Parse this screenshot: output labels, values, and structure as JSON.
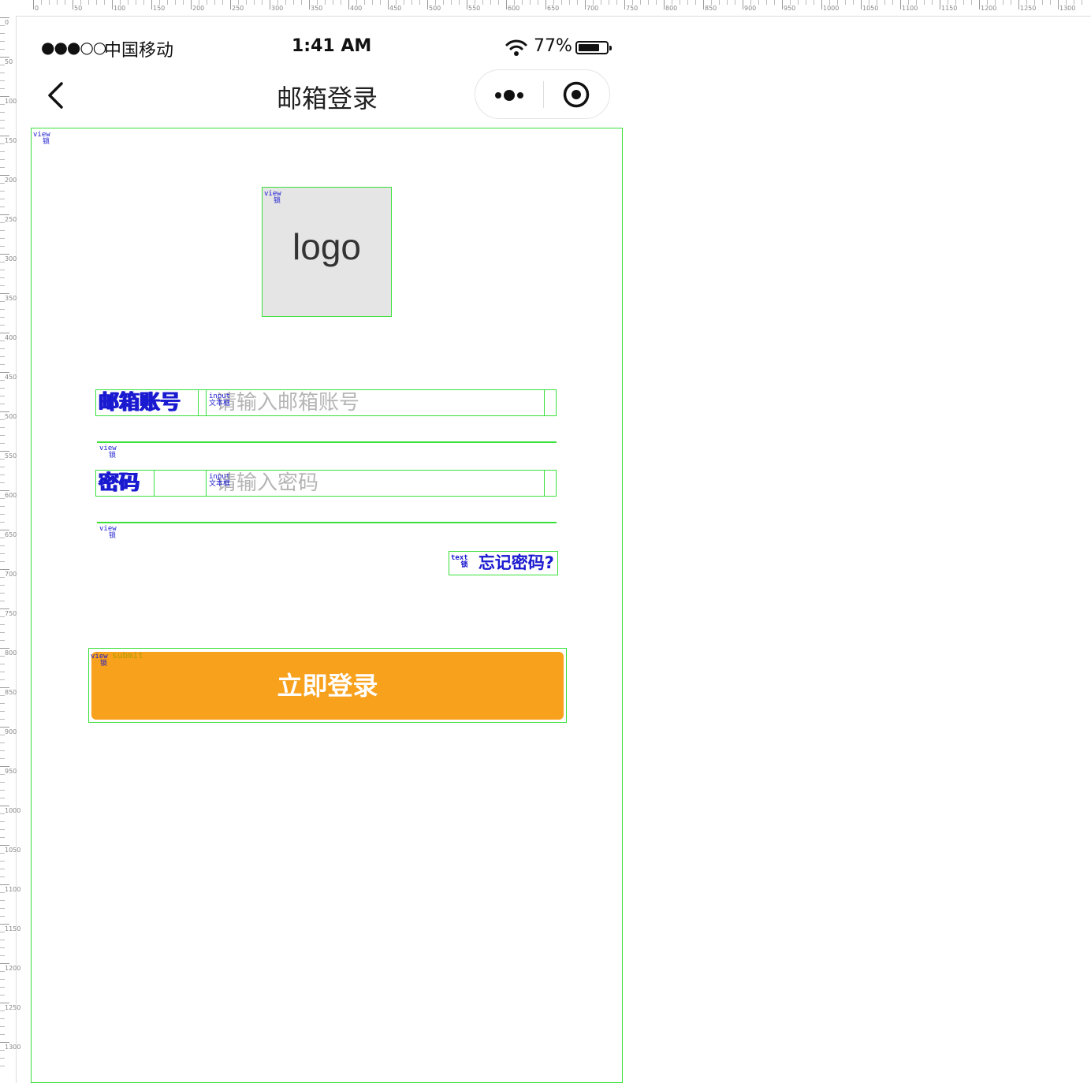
{
  "status_bar": {
    "signal": "●●●○○",
    "carrier": "中国移动",
    "time": "1:41 AM",
    "battery_percent": "77%",
    "battery_level": 0.77
  },
  "nav": {
    "title": "邮箱登录"
  },
  "logo": {
    "text": "logo"
  },
  "form": {
    "email_label": "邮箱账号",
    "email_placeholder": "请输入邮箱账号",
    "password_label": "密码",
    "password_placeholder": "请输入密码",
    "forgot_link": "忘记密码?",
    "submit_label": "立即登录"
  },
  "debug_labels": {
    "view": "view",
    "lock": "锁",
    "input": "input",
    "text_box": "文本框",
    "text": "text",
    "submit": "submit"
  },
  "colors": {
    "accent": "#f8a11c",
    "outline": "#3be03b",
    "debug_text": "#1a1ad0",
    "placeholder": "#b5b5b5"
  },
  "icons": [
    "back-icon",
    "wifi-icon",
    "battery-icon",
    "more-icon",
    "target-icon"
  ]
}
